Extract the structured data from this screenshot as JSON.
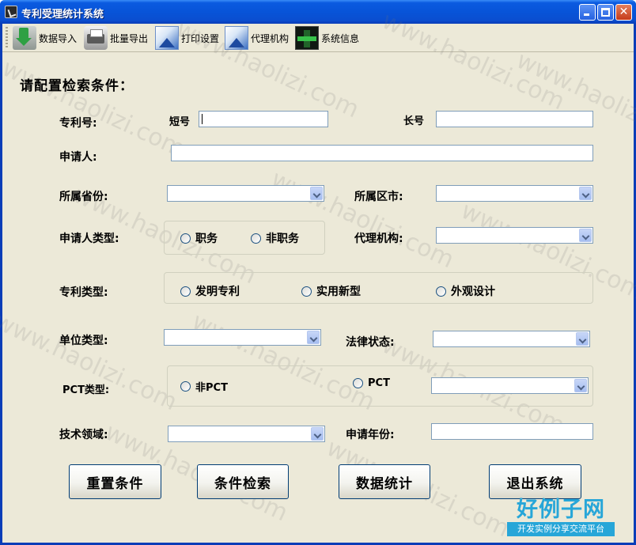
{
  "window": {
    "title": "专利受理统计系统"
  },
  "toolbar": {
    "items": [
      {
        "label": "数据导入",
        "icon": "import-icon"
      },
      {
        "label": "批量导出",
        "icon": "export-icon"
      },
      {
        "label": "打印设置",
        "icon": "print-icon"
      },
      {
        "label": "代理机构",
        "icon": "agency-icon"
      },
      {
        "label": "系统信息",
        "icon": "system-info-icon"
      }
    ]
  },
  "form": {
    "heading": "请配置检索条件：",
    "patent_no": {
      "label": "专利号:",
      "short_label": "短号",
      "short_value": "",
      "long_label": "长号",
      "long_value": ""
    },
    "applicant": {
      "label": "申请人:",
      "value": ""
    },
    "province": {
      "label": "所属省份:",
      "value": ""
    },
    "city": {
      "label": "所属区市:",
      "value": ""
    },
    "applicant_type": {
      "label": "申请人类型:",
      "options": [
        "职务",
        "非职务"
      ]
    },
    "agency": {
      "label": "代理机构:",
      "value": ""
    },
    "patent_type": {
      "label": "专利类型:",
      "options": [
        "发明专利",
        "实用新型",
        "外观设计"
      ]
    },
    "unit_type": {
      "label": "单位类型:",
      "value": ""
    },
    "legal_status": {
      "label": "法律状态:",
      "value": ""
    },
    "pct_type": {
      "label": "PCT类型:",
      "options": [
        "非PCT",
        "PCT"
      ],
      "value": ""
    },
    "tech_field": {
      "label": "技术领域:",
      "value": ""
    },
    "apply_year": {
      "label": "申请年份:",
      "value": ""
    }
  },
  "buttons": {
    "reset": "重置条件",
    "search": "条件检索",
    "stats": "数据统计",
    "exit": "退出系统"
  },
  "watermark": {
    "text": "www.haolizi.com"
  },
  "brand": {
    "main": "好例子网",
    "sub": "开发实例分享交流平台"
  },
  "colors": {
    "titlebar": "#0854D8",
    "window_bg": "#ECE9D8",
    "border": "#7F9DB9",
    "brand": "#27A6D8"
  }
}
